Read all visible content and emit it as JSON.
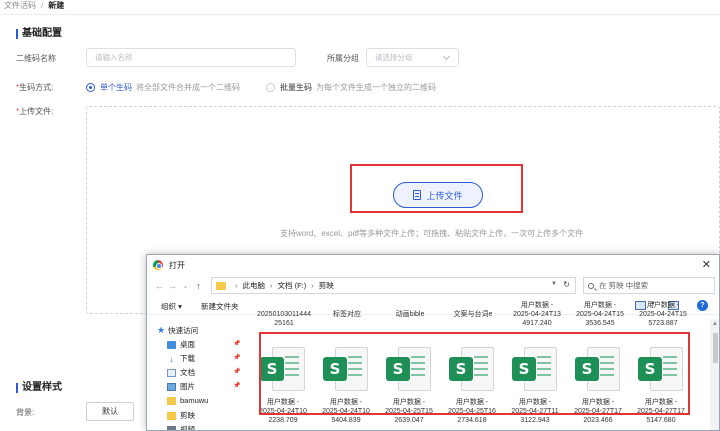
{
  "breadcrumb": {
    "parent": "文件活码",
    "sep": "/",
    "current": "新建"
  },
  "basic": {
    "title": "基础配置",
    "name_label": "二维码名称",
    "name_placeholder": "请输入名称",
    "group_label": "所属分组",
    "group_placeholder": "请选择分组",
    "mode_label": "*生码方式:",
    "mode_single_name": "单个生码",
    "mode_single_desc": "将全部文件合并成一个二维码",
    "mode_batch_name": "批量生码",
    "mode_batch_desc": "为每个文件生成一个独立的二维码",
    "upload_label": "*上传文件:",
    "upload_button": "上传文件",
    "upload_hint": "支持word、excel、pdf等多种文件上传；可拖拽、粘贴文件上传，一次可上传多个文件"
  },
  "style": {
    "title": "设置样式",
    "bg_label": "背景:",
    "bg_default": "默认"
  },
  "colors": {
    "accent": "#2d5bd7",
    "highlight": "#e23636",
    "sheet_green": "#1e8f56"
  },
  "dialog": {
    "title": "打开",
    "close": "✕",
    "back_icon": "←",
    "forward_icon": "→",
    "dropdown_icon": "⌄",
    "up_icon": "↑",
    "path": [
      "此电脑",
      "文档 (F:)",
      "剪映"
    ],
    "refresh_icon": "↻",
    "search_placeholder": "在 剪映 中搜索",
    "organize": "组织 ▾",
    "new_folder": "新建文件夹",
    "help": "?",
    "quick_access": "快速访问",
    "sidebar": [
      {
        "label": "桌面",
        "icon": "desktop-icon",
        "pinned": true
      },
      {
        "label": "下载",
        "icon": "download-icon",
        "pinned": true
      },
      {
        "label": "文档",
        "icon": "document-icon",
        "pinned": true
      },
      {
        "label": "图片",
        "icon": "picture-icon",
        "pinned": true
      },
      {
        "label": "bamuwu",
        "icon": "folder-icon",
        "pinned": false
      },
      {
        "label": "剪映",
        "icon": "folder-icon",
        "pinned": false
      },
      {
        "label": "视频",
        "icon": "folder-icon",
        "pinned": false
      }
    ],
    "top_row": [
      "20250103011444\n25161",
      "标签对应",
      "动画bible",
      "文案与台词e",
      "用户数据 -\n2025-04-24T13\n4917.240",
      "用户数据 -\n2025-04-24T15\n3536.545",
      "用户数据 -\n2025-04-24T15\n5723.887"
    ],
    "files": [
      {
        "icon_letter": "S",
        "name": "用户数据 -\n2025-04-24T10\n2238.709"
      },
      {
        "icon_letter": "S",
        "name": "用户数据 -\n2025-04-24T10\n5404.839"
      },
      {
        "icon_letter": "S",
        "name": "用户数据 -\n2025-04-25T15\n2639.047"
      },
      {
        "icon_letter": "S",
        "name": "用户数据 -\n2025-04-25T16\n2734.618"
      },
      {
        "icon_letter": "S",
        "name": "用户数据 -\n2025-04-27T11\n3122.943"
      },
      {
        "icon_letter": "S",
        "name": "用户数据 -\n2025-04-27T17\n2023.466"
      },
      {
        "icon_letter": "S",
        "name": "用户数据 -\n2025-04-27T17\n5147.680"
      }
    ]
  }
}
